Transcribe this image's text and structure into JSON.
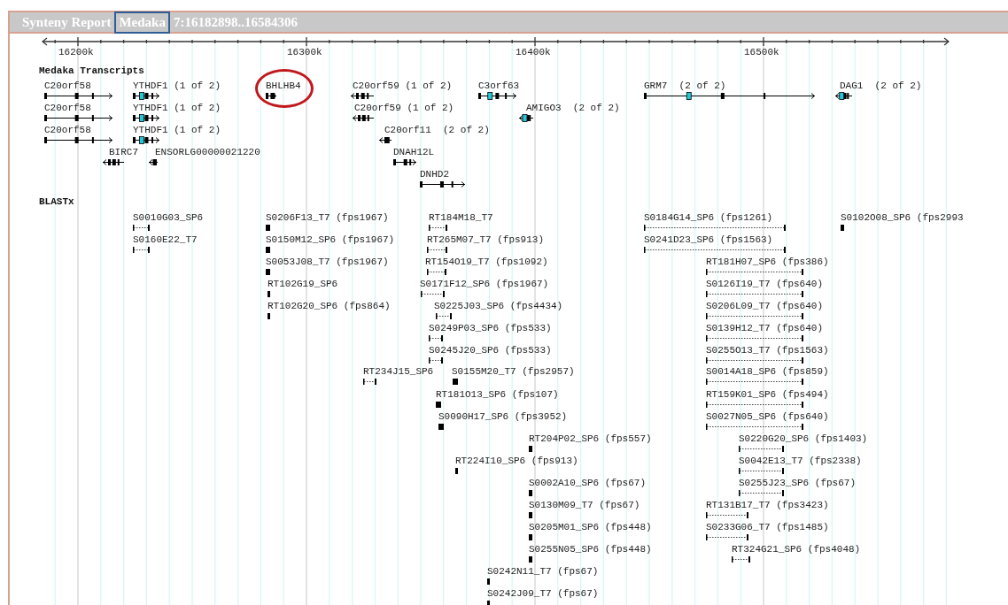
{
  "title": {
    "prefix": "Synteny Report",
    "species": "Medaka",
    "species_boxed": true,
    "location": "7:16182898..16584306"
  },
  "ruler": {
    "ticks": [
      "16200k",
      "16300k",
      "16400k",
      "16500k"
    ]
  },
  "transcripts": {
    "name": "Medaka Transcripts",
    "features": [
      {
        "label": "C20orf58",
        "circled": false
      },
      {
        "label": "YTHDF1 (1 of 2)",
        "circled": false
      },
      {
        "label": "BHLHB4",
        "circled": true
      },
      {
        "label": "C20orf59 (1 of 2)",
        "circled": false
      },
      {
        "label": "C3orf63",
        "circled": false
      },
      {
        "label": "GRM7  (2 of 2)",
        "circled": false
      },
      {
        "label": "DAG1  (2 of 2)",
        "circled": false
      },
      {
        "label": "C20orf58",
        "circled": false
      },
      {
        "label": "YTHDF1 (1 of 2)",
        "circled": false
      },
      {
        "label": "C20orf59 (1 of 2)",
        "circled": false
      },
      {
        "label": "AMIGO3  (2 of 2)",
        "circled": false
      },
      {
        "label": "C20orf58",
        "circled": false
      },
      {
        "label": "YTHDF1 (1 of 2)",
        "circled": false
      },
      {
        "label": "C20orf11  (2 of 2)",
        "circled": false
      },
      {
        "label": "BIRC7",
        "circled": false
      },
      {
        "label": "ENSORLG00000021220",
        "circled": false
      },
      {
        "label": "DNAH12L",
        "circled": false
      },
      {
        "label": "DNHD2",
        "circled": false
      }
    ]
  },
  "blastx": {
    "name": "BLASTx",
    "features": [
      "S0010G03_SP6",
      "S0206F13_T7 (fps1967)",
      "RT184M18_T7",
      "S0184G14_SP6 (fps1261)",
      "S0102O08_SP6 (fps2993",
      "S0160E22_T7",
      "S0150M12_SP6 (fps1967)",
      "RT265M07_T7 (fps913)",
      "S0241D23_SP6 (fps1563)",
      "S0053J08_T7 (fps1967)",
      "RT154O19_T7 (fps1092)",
      "RT181H07_SP6 (fps386)",
      "RT102G19_SP6",
      "S0171F12_SP6 (fps1967)",
      "S0126I19_T7 (fps640)",
      "RT102G20_SP6 (fps864)",
      "S0225J03_SP6 (fps4434)",
      "S0206L09_T7 (fps640)",
      "S0249P03_SP6 (fps533)",
      "S0139H12_T7 (fps640)",
      "S0245J20_SP6 (fps533)",
      "S0255O13_T7 (fps1563)",
      "RT234J15_SP6",
      "S0155M20_T7 (fps2957)",
      "S0014A18_SP6 (fps859)",
      "RT181O13_SP6 (fps107)",
      "RT159K01_SP6 (fps494)",
      "S0090H17_SP6 (fps3952)",
      "S0027N05_SP6 (fps640)",
      "RT204P02_SP6 (fps557)",
      "S0220G20_SP6 (fps1403)",
      "RT224I10_SP6 (fps913)",
      "S0042E13_T7 (fps2338)",
      "S0002A10_SP6 (fps67)",
      "S0255J23_SP6 (fps67)",
      "S0130M09_T7 (fps67)",
      "RT131B17_T7 (fps3423)",
      "S0205M01_SP6 (fps448)",
      "S0233G06_T7 (fps1485)",
      "S0255N05_SP6 (fps448)",
      "RT324G21_SP6 (fps4048)",
      "S0242N11_T7 (fps67)",
      "S0242J09_T7 (fps67)"
    ]
  }
}
